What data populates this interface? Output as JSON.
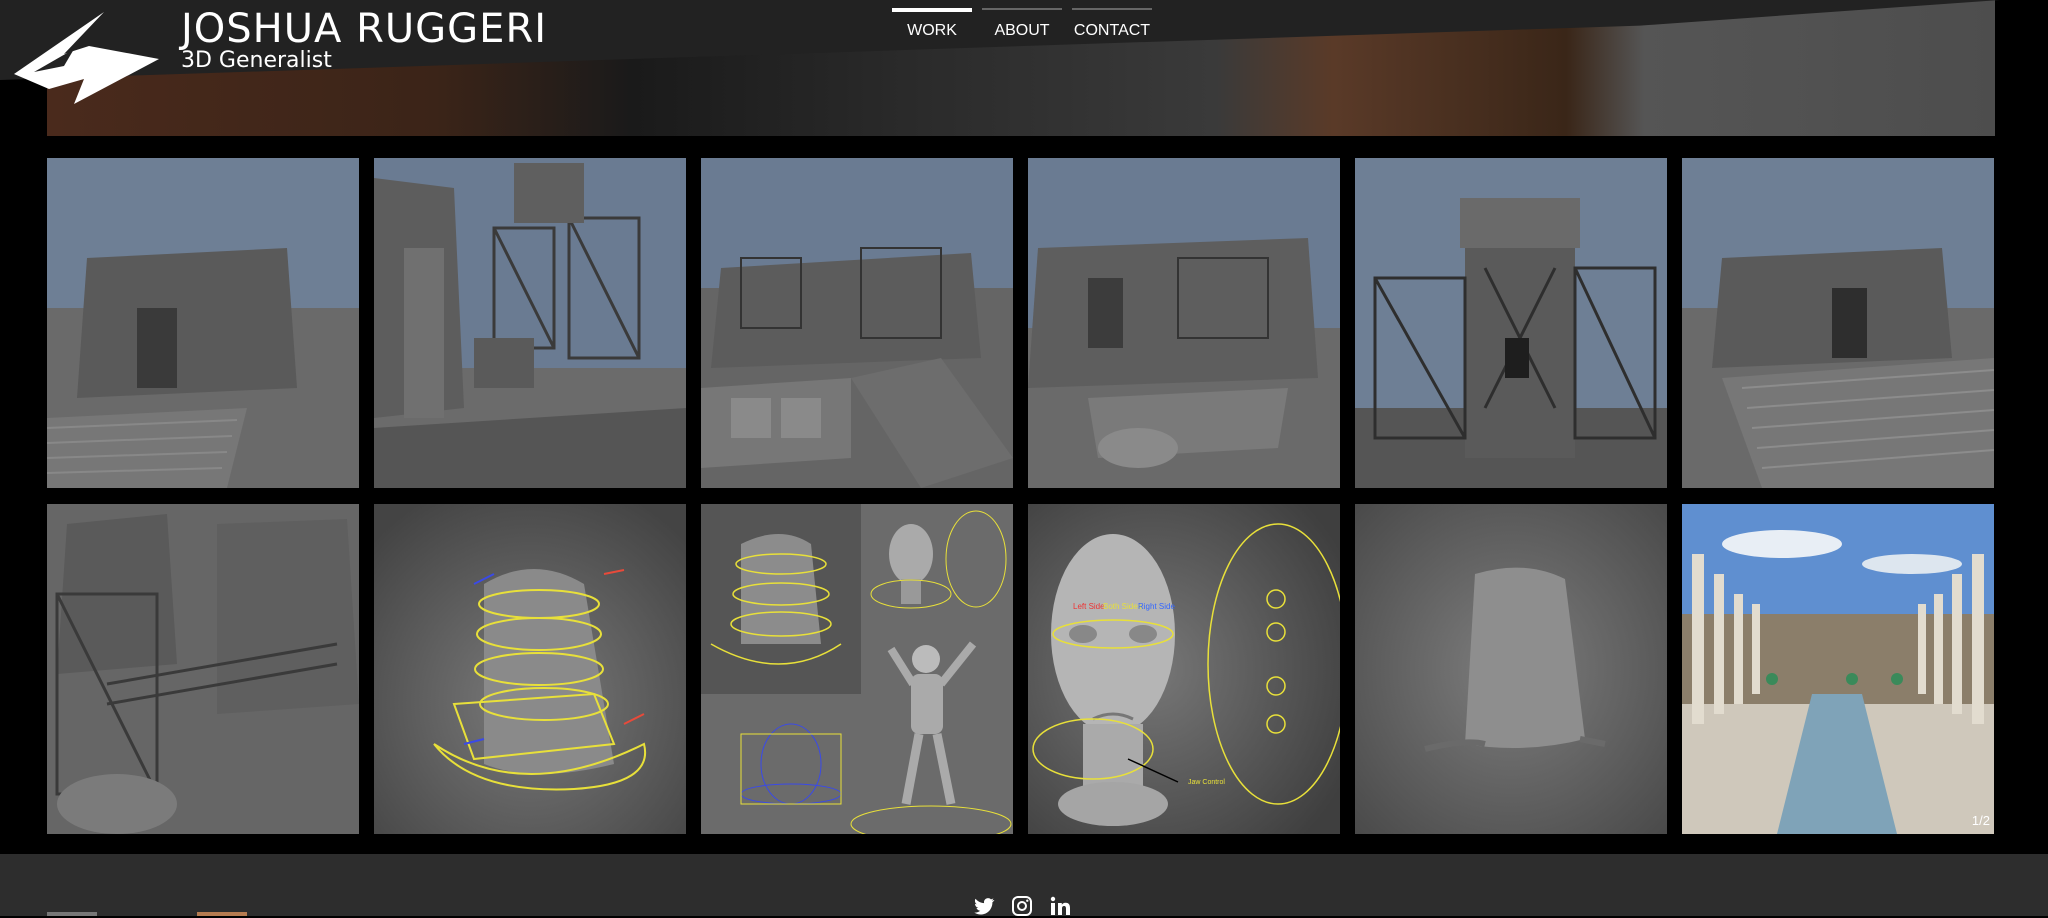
{
  "site": {
    "title": "JOSHUA RUGGERI",
    "subtitle": "3D Generalist"
  },
  "nav": {
    "items": [
      {
        "label": "WORK",
        "active": true
      },
      {
        "label": "ABOUT",
        "active": false
      },
      {
        "label": "CONTACT",
        "active": false
      }
    ]
  },
  "gallery": {
    "counter": "1/2",
    "tiles": [
      {
        "name": "ruins-render-1"
      },
      {
        "name": "ruins-render-2"
      },
      {
        "name": "ruins-render-3"
      },
      {
        "name": "ruins-render-4"
      },
      {
        "name": "ruins-render-5"
      },
      {
        "name": "ruins-render-6"
      },
      {
        "name": "ruins-render-7"
      },
      {
        "name": "sack-rig-render"
      },
      {
        "name": "character-rig-sheet"
      },
      {
        "name": "face-rig-render"
      },
      {
        "name": "sack-render"
      },
      {
        "name": "courtyard-render"
      }
    ],
    "rig_labels": {
      "left_side": "Left Side",
      "both_sides": "Both Sides",
      "right_side": "Right Side",
      "jaw_control": "Jaw Control"
    }
  },
  "footer": {
    "social": [
      "twitter-icon",
      "instagram-icon",
      "linkedin-icon"
    ]
  },
  "colors": {
    "background": "#000000",
    "header": "#232323",
    "footer": "#2d2d2d",
    "rig_yellow": "#e8e03a"
  }
}
